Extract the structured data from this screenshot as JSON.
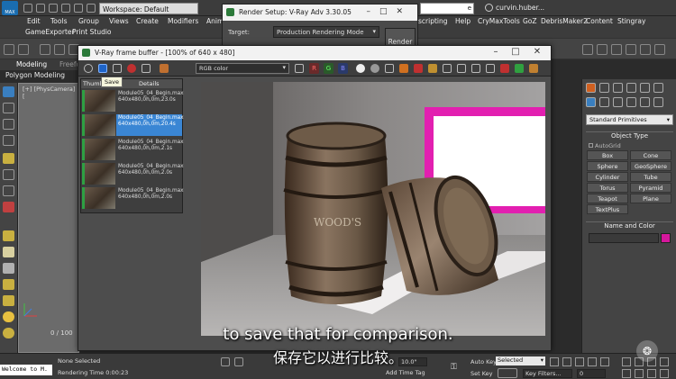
{
  "titlebar": {
    "logo": "MAX",
    "workspace": "Workspace: Default",
    "user": "curvin.huber...",
    "search_tail": "e"
  },
  "menubar": {
    "items": [
      "Edit",
      "Tools",
      "Group",
      "Views",
      "Create",
      "Modifiers",
      "Anim"
    ],
    "right_items": [
      "scripting",
      "Help",
      "CryMaxTools",
      "GoZ",
      "DebrisMaker2",
      "Content",
      "Stingray"
    ]
  },
  "toolbar1": {
    "items": [
      "GameExporter",
      "Print Studio"
    ]
  },
  "ribbon": {
    "tabs": [
      "Modeling",
      "Freefo"
    ],
    "sub": "Polygon Modeling"
  },
  "viewport": {
    "label": "[+] [PhysCamera] [",
    "frames": "0 / 100"
  },
  "render_setup": {
    "title": "Render Setup: V-Ray Adv 3.30.05",
    "target_label": "Target:",
    "target_value": "Production Rendering Mode",
    "render_button": "Render"
  },
  "vfb": {
    "title": "V-Ray frame buffer - [100% of 640 x 480]",
    "channel": "RGB color",
    "rgb": [
      "R",
      "G",
      "B"
    ],
    "tooltip": "Save",
    "history": {
      "headers": [
        "Thumb",
        "Details"
      ],
      "rows": [
        {
          "file": "Module05_04_Begin.max",
          "info": "640x480,0h,0m,23.0s",
          "selected": false
        },
        {
          "file": "Module05_04_Begin.max",
          "info": "640x480,0h,0m,20.4s",
          "selected": true
        },
        {
          "file": "Module05_04_Begin.max",
          "info": "640x480,0h,0m,2.1s",
          "selected": false
        },
        {
          "file": "Module05_04_Begin.max",
          "info": "640x480,0h,0m,2.0s",
          "selected": false
        },
        {
          "file": "Module05_04_Begin.max",
          "info": "640x480,0h,0m,2.0s",
          "selected": false
        }
      ]
    },
    "barrel_text": "WOOD'S"
  },
  "command_panel": {
    "dropdown": "Standard Primitives",
    "object_type": "Object Type",
    "autogrid": "AutoGrid",
    "buttons": [
      "Box",
      "Cone",
      "Sphere",
      "GeoSphere",
      "Cylinder",
      "Tube",
      "Torus",
      "Pyramid",
      "Teapot",
      "Plane",
      "TextPlus"
    ],
    "name_and_color": "Name and Color",
    "swatch_color": "#d6179c"
  },
  "status": {
    "maxscript": "Welcome to M.",
    "none_selected": "None Selected",
    "rendering_time": "Rendering Time  0:00:23",
    "coord_tail": "10.0\"",
    "auto_key": "Auto Key",
    "selected_dd": "Selected",
    "set_key": "Set Key",
    "key_filters": "Key Filters...",
    "add_time_tag": "Add Time Tag",
    "frame": "0"
  },
  "subtitles": {
    "en": "to save that for comparison.",
    "zh": "保存它以进行比较。"
  },
  "colors": {
    "accent": "#3a86d4",
    "magenta_window": "#d6179c"
  }
}
